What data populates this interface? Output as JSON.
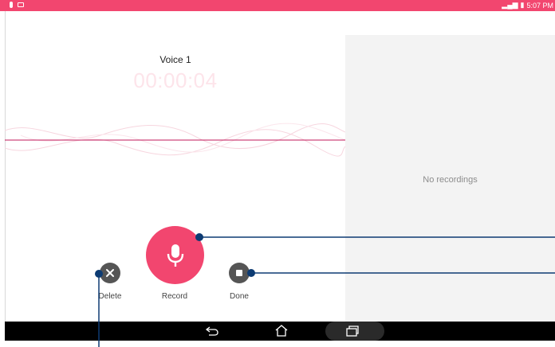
{
  "statusbar": {
    "time": "5:07 PM",
    "accent": "#f2466f"
  },
  "recorder": {
    "title": "Voice 1",
    "timer": "00:00:04"
  },
  "recordings_panel": {
    "empty_text": "No recordings"
  },
  "controls": {
    "delete_label": "Delete",
    "record_label": "Record",
    "done_label": "Done"
  },
  "icons": {
    "delete": "close-icon",
    "record": "microphone-icon",
    "done": "stop-icon",
    "back": "back-icon",
    "home": "home-icon",
    "recent": "recent-apps-icon"
  },
  "colors": {
    "record_button": "#f2466f",
    "waveform_line": "#c2185b",
    "callout": "#0d3b73"
  }
}
